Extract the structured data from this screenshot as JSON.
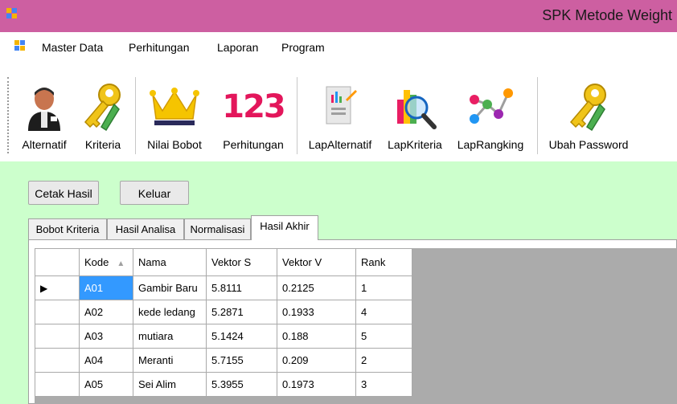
{
  "window": {
    "title": "SPK Metode Weight"
  },
  "menu": {
    "items": [
      "Master Data",
      "Perhitungan",
      "Laporan",
      "Program"
    ]
  },
  "toolbar": {
    "buttons": [
      {
        "label": "Alternatif",
        "icon": "person-icon"
      },
      {
        "label": "Kriteria",
        "icon": "keys-icon"
      },
      {
        "label": "Nilai Bobot",
        "icon": "crown-icon"
      },
      {
        "label": "Perhitungan",
        "icon": "numbers-123-icon"
      },
      {
        "label": "LapAlternatif",
        "icon": "report-icon"
      },
      {
        "label": "LapKriteria",
        "icon": "magnifier-chart-icon"
      },
      {
        "label": "LapRangking",
        "icon": "network-icon"
      },
      {
        "label": "Ubah Password",
        "icon": "keys-icon"
      }
    ]
  },
  "actions": {
    "print_label": "Cetak Hasil",
    "exit_label": "Keluar"
  },
  "tabs": [
    {
      "label": "Bobot Kriteria",
      "active": false
    },
    {
      "label": "Hasil Analisa",
      "active": false
    },
    {
      "label": "Normalisasi",
      "active": false
    },
    {
      "label": "Hasil Akhir",
      "active": true
    }
  ],
  "grid": {
    "columns": [
      "Kode",
      "Nama",
      "Vektor S",
      "Vektor V",
      "Rank"
    ],
    "sort_indicator": "▲",
    "current_row_marker": "▶",
    "rows": [
      {
        "kode": "A01",
        "nama": "Gambir Baru",
        "vektor_s": "5.8111",
        "vektor_v": "0.2125",
        "rank": "1"
      },
      {
        "kode": "A02",
        "nama": "kede ledang",
        "vektor_s": "5.2871",
        "vektor_v": "0.1933",
        "rank": "4"
      },
      {
        "kode": "A03",
        "nama": "mutiara",
        "vektor_s": "5.1424",
        "vektor_v": "0.188",
        "rank": "5"
      },
      {
        "kode": "A04",
        "nama": "Meranti",
        "vektor_s": "5.7155",
        "vektor_v": "0.209",
        "rank": "2"
      },
      {
        "kode": "A05",
        "nama": "Sei Alim",
        "vektor_s": "5.3955",
        "vektor_v": "0.1973",
        "rank": "3"
      }
    ]
  },
  "colors": {
    "titlebar": "#cd5fa1",
    "form_background": "#ccffcc",
    "selection": "#3399ff",
    "grid_empty": "#ababab"
  }
}
